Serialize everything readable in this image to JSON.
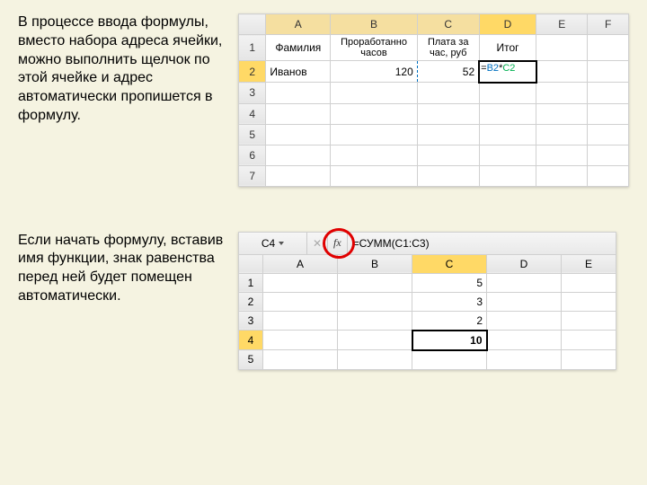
{
  "section1": {
    "text": "В процессе ввода формулы, вместо набора адреса ячейки, можно выполнить щелчок по этой ячейке и адрес автоматически пропишется в формулу.",
    "columns": [
      "A",
      "B",
      "C",
      "D",
      "E",
      "F"
    ],
    "headers": {
      "A": "Фамилия",
      "B": "Проработанно часов",
      "C": "Плата за час, руб",
      "D": "Итог"
    },
    "row2": {
      "A": "Иванов",
      "B": "120",
      "C": "52",
      "formula": "=B2*C2"
    },
    "rows": [
      "1",
      "2",
      "3",
      "4",
      "5",
      "6",
      "7"
    ]
  },
  "section2": {
    "text": "Если начать формулу, вставив имя функции, знак равенства перед ней будет помещен автоматически.",
    "namebox": "C4",
    "fx": "fx",
    "formula": "=СУММ(C1:C3)",
    "columns": [
      "A",
      "B",
      "C",
      "D",
      "E"
    ],
    "rows": [
      "1",
      "2",
      "3",
      "4",
      "5"
    ],
    "data": {
      "C1": "5",
      "C2": "3",
      "C3": "2",
      "C4": "10"
    }
  }
}
